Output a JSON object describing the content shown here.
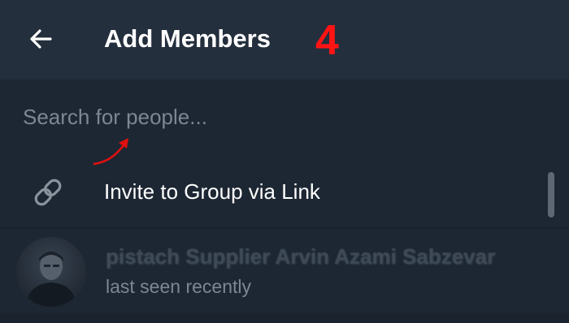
{
  "header": {
    "back_icon": "arrow-left-icon",
    "title": "Add Members",
    "annotation_step": "4",
    "annotation_color": "#ff1414"
  },
  "search": {
    "placeholder": "Search for people...",
    "value": ""
  },
  "invite": {
    "icon": "link-icon",
    "label": "Invite to Group via Link"
  },
  "members": [
    {
      "name": "pistach Supplier Arvin Azami Sabzevar",
      "status": "last seen recently"
    }
  ],
  "colors": {
    "header_bg": "#242f3d",
    "page_bg": "#1d2733",
    "text_primary": "#ffffff",
    "text_secondary": "#7b8793"
  }
}
